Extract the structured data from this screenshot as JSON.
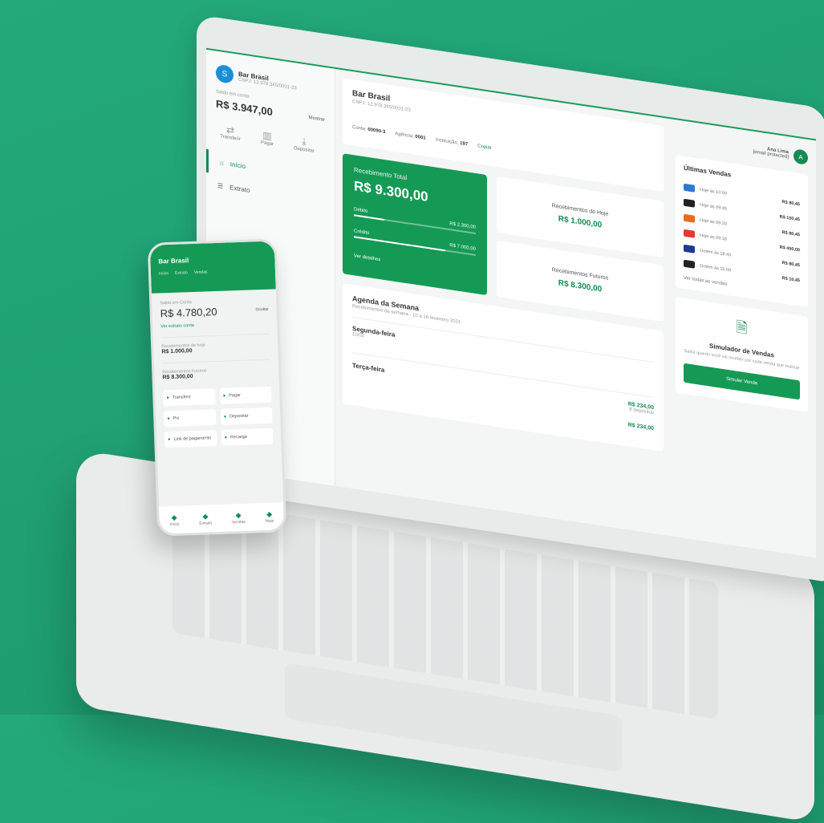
{
  "brand": "stone",
  "account": {
    "avatar_letter": "S",
    "name": "Bar Brasil",
    "subtitle": "CNPJ: 12.978.345/0001-23",
    "balance_label": "Saldo em conta",
    "balance": "R$ 3.947,00",
    "show_label": "Mostrar"
  },
  "side_actions": [
    {
      "label": "Transferir",
      "icon": "transfer-icon"
    },
    {
      "label": "Pagar",
      "icon": "barcode-icon"
    },
    {
      "label": "Depositar",
      "icon": "deposit-icon"
    }
  ],
  "menu": [
    {
      "label": "Início",
      "icon": "home-icon"
    },
    {
      "label": "Extrato",
      "icon": "list-icon"
    }
  ],
  "store": {
    "name": "Bar Brasil",
    "cnpj": "CNPJ: 12.978.345/0001-23",
    "conta_label": "Conta:",
    "conta": "00090-3",
    "agencia_label": "Agência:",
    "agencia": "0001",
    "instituicao_label": "Instituição:",
    "instituicao": "197",
    "copy": "Copiar"
  },
  "total": {
    "label": "Recebimento Total",
    "value": "R$ 9.300,00",
    "debito_label": "Débito",
    "debito": "R$ 2.300,00",
    "debito_fill": 0.25,
    "credito_label": "Crédito",
    "credito": "R$ 7.000,00",
    "credito_fill": 0.75,
    "details": "Ver detalhes"
  },
  "today": {
    "label": "Recebimentos de Hoje",
    "value": "R$ 1.000,00"
  },
  "future": {
    "label": "Recebimentos Futuros",
    "value": "R$ 8.300,00"
  },
  "agenda": {
    "title": "Agenda da Semana",
    "subtitle": "Recebimentos da semana - 10 a 16 fevereiro 2021",
    "items": [
      {
        "day": "Segunda-feira",
        "sub": "10/02",
        "amount": "",
        "count": ""
      },
      {
        "day": "Terça-feira",
        "sub": "",
        "amount": "R$ 234,00",
        "count": "8 depósitos"
      }
    ],
    "extra_amount": "R$ 234,00"
  },
  "user": {
    "name": "Ana Lima",
    "email": "[email protected]",
    "initial": "A"
  },
  "sales": {
    "title": "Últimas Vendas",
    "items": [
      {
        "brand": "amex",
        "color": "#2e77d0",
        "desc": "Hoje às 10:00",
        "amount": "R$ 80,45"
      },
      {
        "brand": "elo",
        "color": "#222222",
        "desc": "Hoje às 09:45",
        "amount": "R$ 100,45"
      },
      {
        "brand": "mastercard",
        "color": "#eb6b1c",
        "desc": "Hoje às 09:20",
        "amount": "R$ 80,45"
      },
      {
        "brand": "mastercard",
        "color": "#e53935",
        "desc": "Hoje às 09:18",
        "amount": "R$ 450,00"
      },
      {
        "brand": "visa",
        "color": "#1a3d8f",
        "desc": "Ontem às 18:40",
        "amount": "R$ 80,45"
      },
      {
        "brand": "elo",
        "color": "#222222",
        "desc": "Ontem às 15:00",
        "amount": "R$ 10,45"
      }
    ],
    "see_all": "Ver todas as vendas"
  },
  "simulator": {
    "title": "Simulador de Vendas",
    "desc": "Saiba quanto você vai receber por cada venda que realizar",
    "button": "Simular Venda"
  },
  "phone": {
    "name": "Bar Brasil",
    "tabs": [
      "Início",
      "Extrato",
      "Vendas"
    ],
    "balance_label": "Saldo em Conta",
    "balance": "R$ 4.780,20",
    "show": "Ocultar",
    "link": "Ver extrato conta",
    "rec_label": "Recebimentos de hoje",
    "rec_value": "R$ 1.000,00",
    "future_label": "Recebimentos Futuros",
    "future_value": "R$ 8.300,00",
    "actions": [
      "Transferir",
      "Pagar",
      "Pix",
      "Depositar",
      "Link de pagamento",
      "Recarga"
    ],
    "nav": [
      "Início",
      "Extrato",
      "Vendas",
      "Mais"
    ]
  }
}
